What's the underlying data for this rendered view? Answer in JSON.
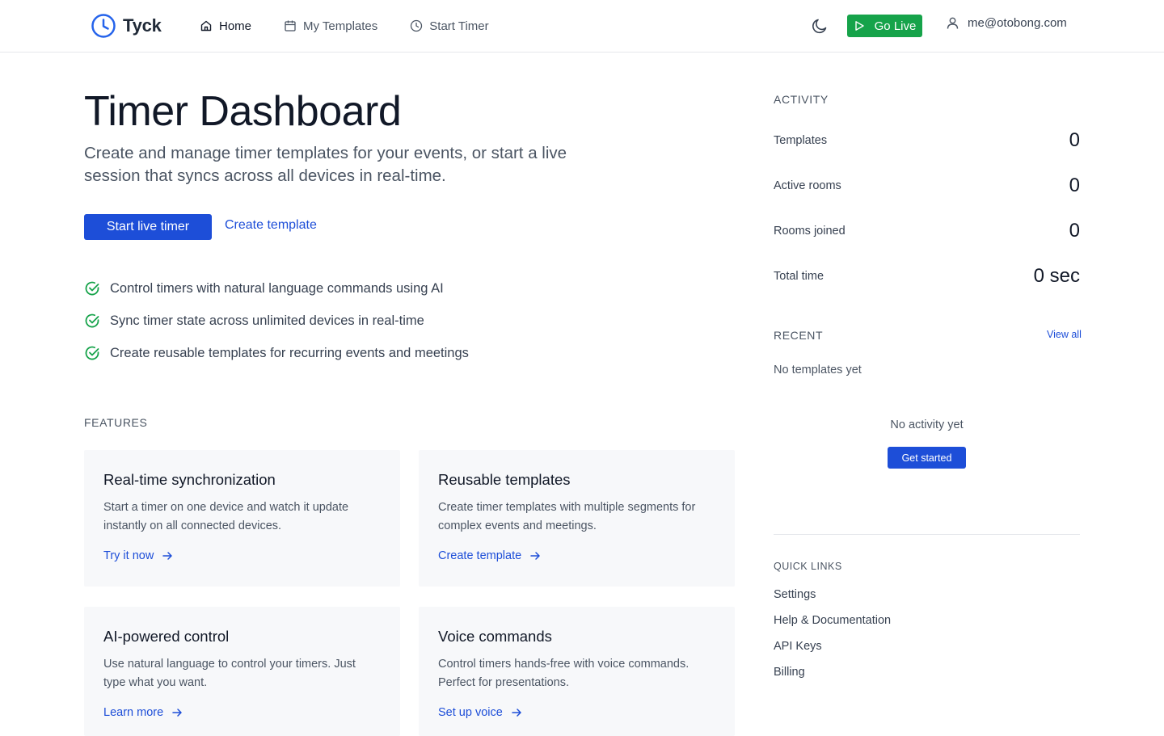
{
  "app": {
    "name": "Tyck"
  },
  "nav": {
    "items": [
      {
        "label": "Home",
        "icon": "home-icon",
        "active": true
      },
      {
        "label": "My Templates",
        "icon": "calendar-icon",
        "active": false
      },
      {
        "label": "Start Timer",
        "icon": "clock-icon",
        "active": false
      }
    ]
  },
  "header": {
    "go_live_label": "Go Live",
    "user_email": "me@otobong.com"
  },
  "main": {
    "title": "Timer Dashboard",
    "subtitle": "Create and manage timer templates for your events, or start a live session that syncs across all devices in real-time.",
    "primary_button": "Start live timer",
    "secondary_link": "Create template",
    "checks": [
      "Control timers with natural language commands using AI",
      "Sync timer state across unlimited devices in real-time",
      "Create reusable templates for recurring events and meetings"
    ],
    "features_label": "FEATURES",
    "features": [
      {
        "title": "Real-time synchronization",
        "desc": "Start a timer on one device and watch it update instantly on all connected devices.",
        "link": "Try it now"
      },
      {
        "title": "Reusable templates",
        "desc": "Create timer templates with multiple segments for complex events and meetings.",
        "link": "Create template"
      },
      {
        "title": "AI-powered control",
        "desc": "Use natural language to control your timers. Just type what you want.",
        "link": "Learn more"
      },
      {
        "title": "Voice commands",
        "desc": "Control timers hands-free with voice commands. Perfect for presentations.",
        "link": "Set up voice"
      }
    ]
  },
  "sidebar": {
    "activity_label": "ACTIVITY",
    "stats": [
      {
        "label": "Templates",
        "value": "0"
      },
      {
        "label": "Active rooms",
        "value": "0"
      },
      {
        "label": "Rooms joined",
        "value": "0"
      },
      {
        "label": "Total time",
        "value": "0 sec"
      }
    ],
    "recent_label": "RECENT",
    "view_all": "View all",
    "no_templates": "No templates yet",
    "no_activity": "No activity yet",
    "get_started": "Get started",
    "quick_links_label": "QUICK LINKS",
    "quick_links": [
      "Settings",
      "Help & Documentation",
      "API Keys",
      "Billing"
    ]
  },
  "colors": {
    "primary": "#1d4ed8",
    "success": "#16a34a",
    "check": "#16a34a",
    "logo": "#2563eb"
  }
}
